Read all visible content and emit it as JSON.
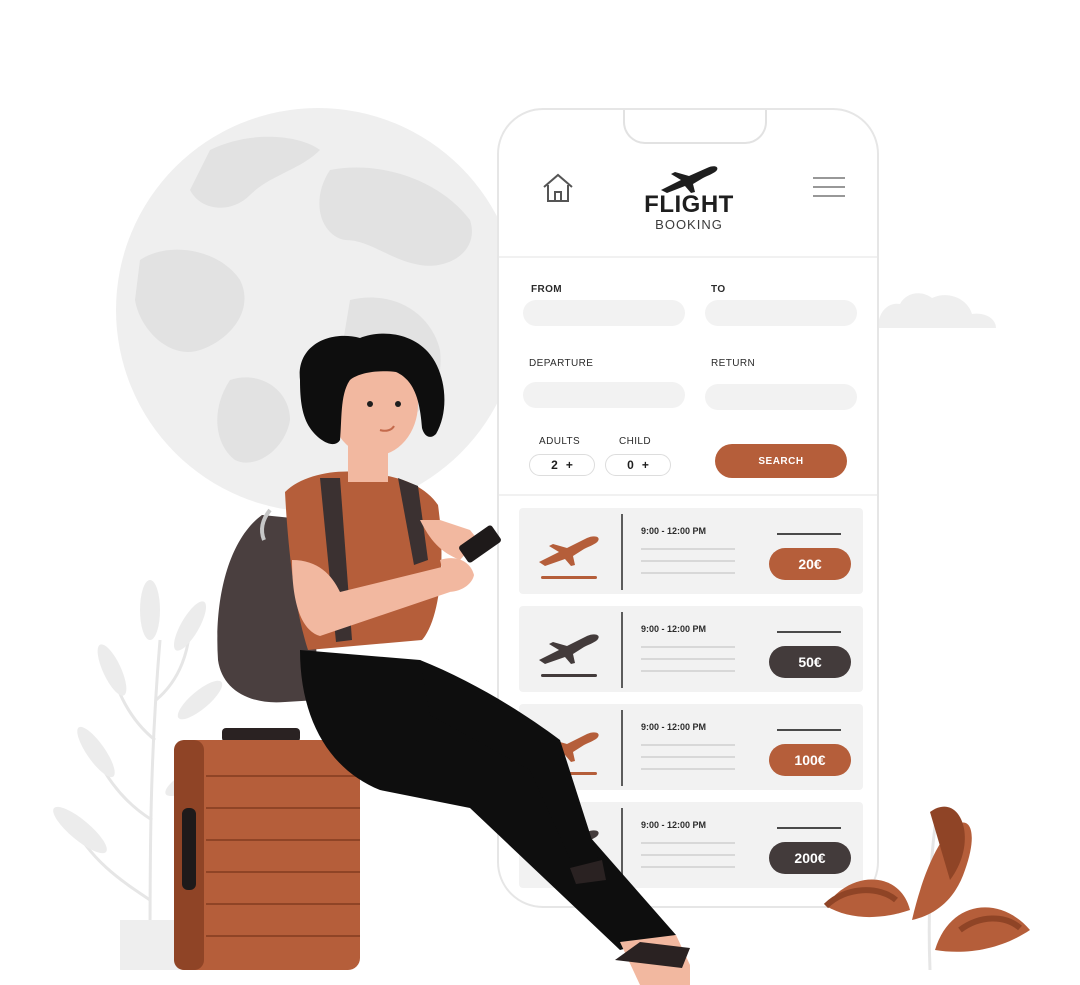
{
  "colors": {
    "accent": "#b55e3a",
    "dark": "#433b3b",
    "field": "#f2f2f2",
    "globe": "#eeeeee"
  },
  "app": {
    "logo_title": "FLIGHT",
    "logo_subtitle": "BOOKING"
  },
  "form": {
    "from_label": "FROM",
    "to_label": "TO",
    "departure_label": "DEPARTURE",
    "return_label": "RETURN",
    "adults_label": "ADULTS",
    "adults_value": "2",
    "child_label": "CHILD",
    "child_value": "0",
    "stepper_plus": "+",
    "search_label": "SEARCH"
  },
  "results": [
    {
      "time": "9:00 - 12:00 PM",
      "price": "20€",
      "style": "accent"
    },
    {
      "time": "9:00 - 12:00 PM",
      "price": "50€",
      "style": "dark"
    },
    {
      "time": "9:00 - 12:00 PM",
      "price": "100€",
      "style": "accent"
    },
    {
      "time": "9:00 - 12:00 PM",
      "price": "200€",
      "style": "dark"
    }
  ]
}
